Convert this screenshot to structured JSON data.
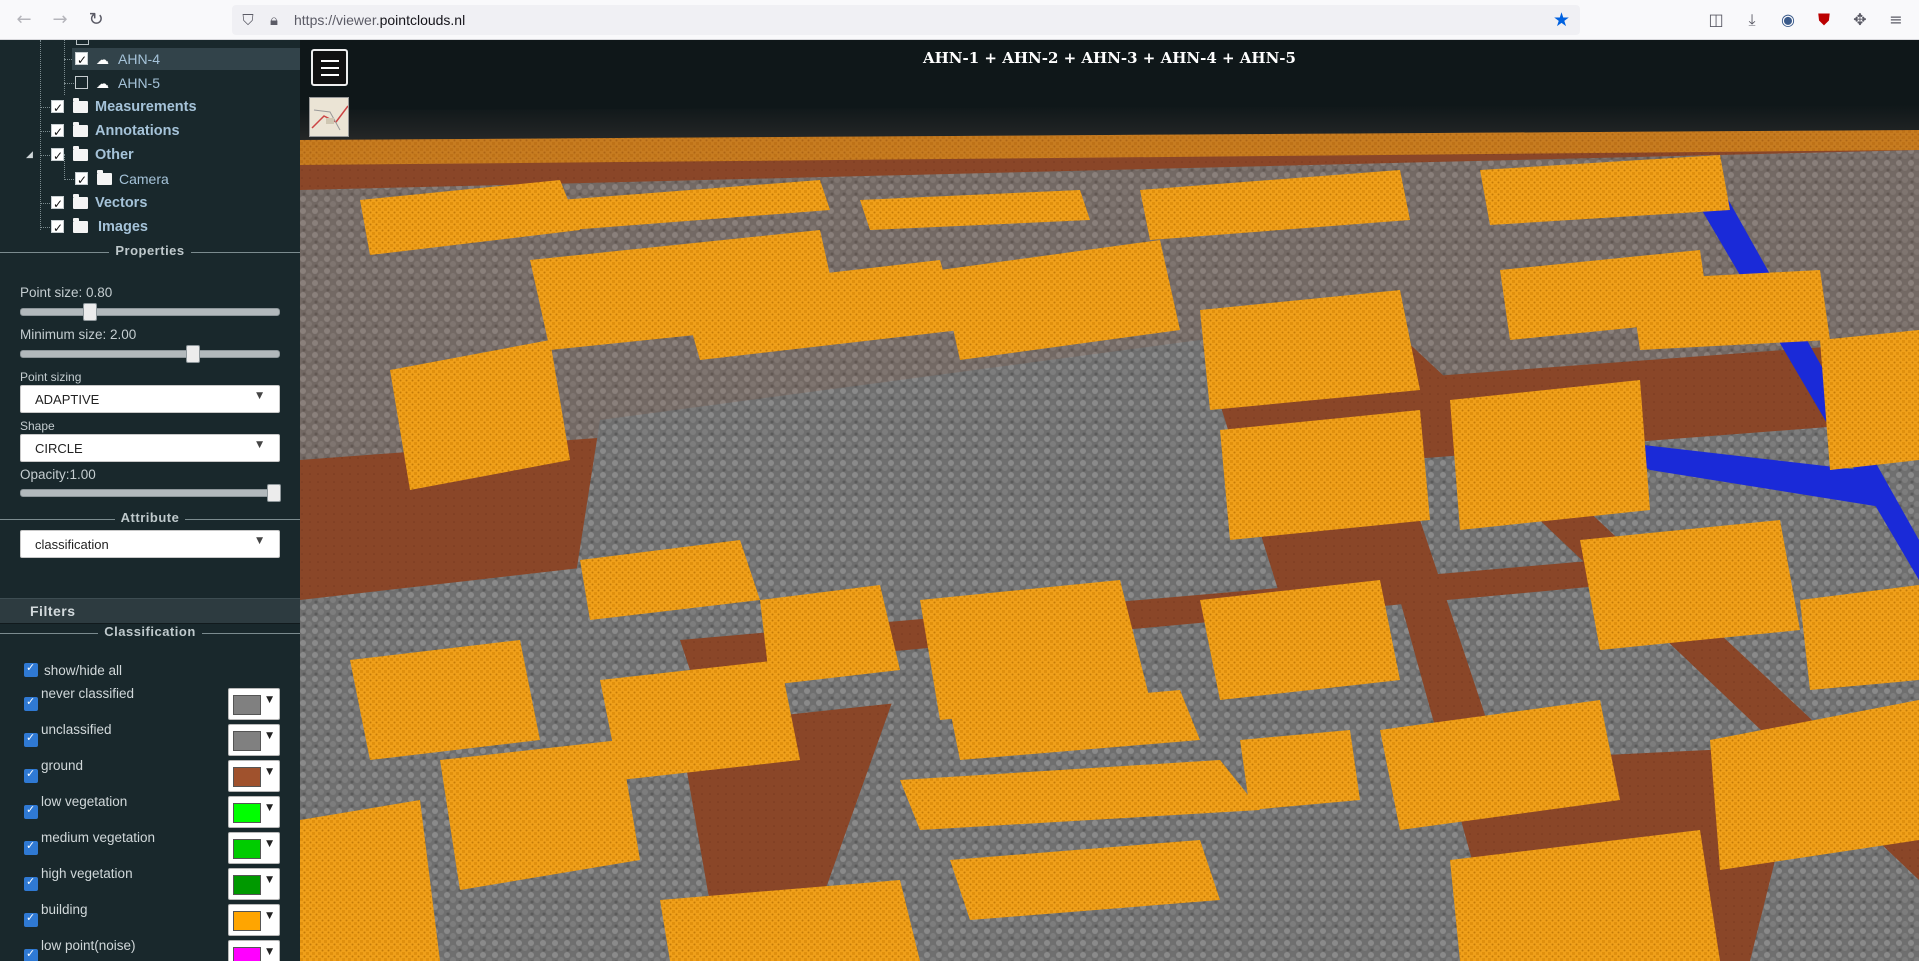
{
  "browser": {
    "url_prefix": "https://viewer.",
    "url_domain": "pointclouds.nl"
  },
  "tree": {
    "items": [
      {
        "label": "AHN-4",
        "checked": true
      },
      {
        "label": "AHN-5",
        "checked": false
      },
      {
        "label": "Measurements",
        "checked": true
      },
      {
        "label": "Annotations",
        "checked": true
      },
      {
        "label": "Other",
        "checked": true
      },
      {
        "label": "Camera",
        "checked": true
      },
      {
        "label": "Vectors",
        "checked": true
      },
      {
        "label": "Images",
        "checked": true
      }
    ]
  },
  "properties": {
    "title": "Properties",
    "point_size_label": "Point size: 0.80",
    "point_size_value": 0.8,
    "min_size_label": "Minimum size: 2.00",
    "min_size_value": 2.0,
    "point_sizing_label": "Point sizing",
    "point_sizing_value": "ADAPTIVE",
    "shape_label": "Shape",
    "shape_value": "CIRCLE",
    "opacity_label": "Opacity:1.00",
    "opacity_value": 1.0,
    "attribute_title": "Attribute",
    "attribute_value": "classification"
  },
  "filters": {
    "label": "Filters",
    "classification_title": "Classification",
    "show_hide_all": "show/hide all",
    "classes": [
      {
        "label": "never classified",
        "color": "#808080"
      },
      {
        "label": "unclassified",
        "color": "#808080"
      },
      {
        "label": "ground",
        "color": "#a0522d"
      },
      {
        "label": "low vegetation",
        "color": "#00ff00"
      },
      {
        "label": "medium vegetation",
        "color": "#00cc00"
      },
      {
        "label": "high vegetation",
        "color": "#009900"
      },
      {
        "label": "building",
        "color": "#ffa500"
      },
      {
        "label": "low point(noise)",
        "color": "#ff00ff"
      }
    ]
  },
  "viewer": {
    "title": "AHN-1 + AHN-2 + AHN-3 + AHN-4 + AHN-5",
    "colors": {
      "building": "#f0a01a",
      "ground": "#8a4628",
      "vegetation": "#7a7a7a",
      "water": "#1a2ad8",
      "sky": "#0f1719"
    }
  }
}
